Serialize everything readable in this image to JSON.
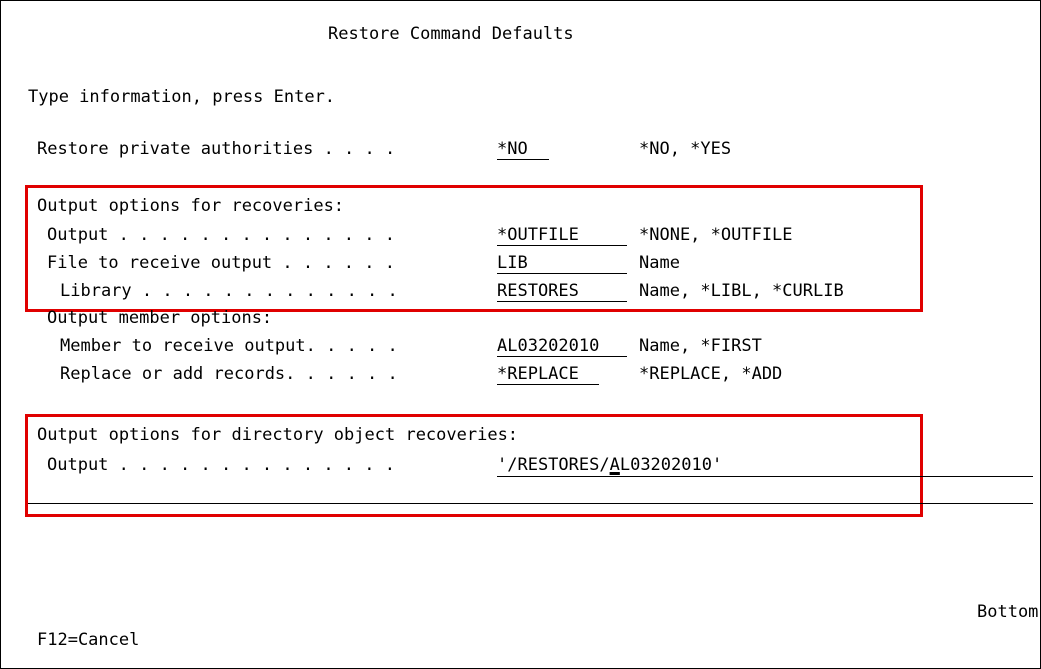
{
  "screen": {
    "title": "Restore Command Defaults",
    "instruction": "Type information, press Enter.",
    "position_indicator": "Bottom",
    "function_keys": "F12=Cancel"
  },
  "private_auth": {
    "label": "Restore private authorities . . . .",
    "value": "*NO",
    "choices": "*NO, *YES"
  },
  "recoveries": {
    "heading": "Output options for recoveries:",
    "output": {
      "label": "Output . . . . . . . . . . . . . .",
      "value": "*OUTFILE",
      "choices": "*NONE, *OUTFILE"
    },
    "file": {
      "label": "File to receive output . . . . . .",
      "value": "LIB",
      "choices": "Name"
    },
    "library": {
      "label": "Library . . . . . . . . . . . . .",
      "value": "RESTORES",
      "choices": "Name, *LIBL, *CURLIB"
    },
    "member_heading": "Output member options:",
    "member": {
      "label": "Member to receive output. . . . .",
      "value": "AL03202010",
      "choices": "Name, *FIRST"
    },
    "replace": {
      "label": "Replace or add records. . . . . .",
      "value": "*REPLACE",
      "choices": "*REPLACE, *ADD"
    }
  },
  "directory": {
    "heading": "Output options for directory object recoveries:",
    "output": {
      "label": "Output . . . . . . . . . . . . . .",
      "value_before_cursor": "'/RESTORES/",
      "value_cursor_char": "A",
      "value_after_cursor": "L03202010'"
    }
  },
  "colors": {
    "highlight": "#e00000"
  }
}
